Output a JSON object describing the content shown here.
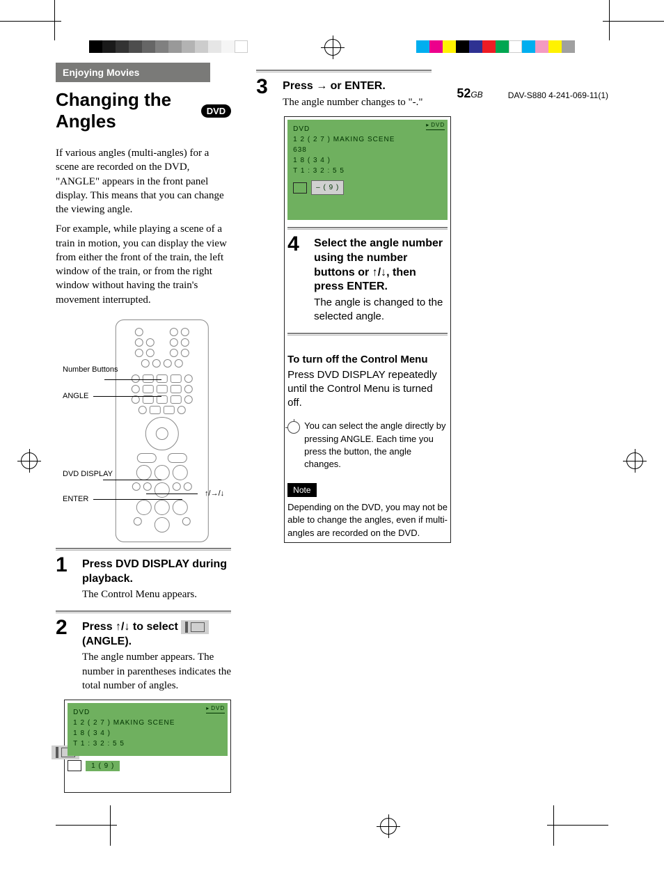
{
  "header": {
    "section_label": "Enjoying Movies",
    "title": "Changing the Angles",
    "title_badge": "DVD"
  },
  "intro": {
    "p1": "If various angles (multi-angles) for a scene are recorded on the DVD, \"ANGLE\" appears in the front panel display. This means that you can change the viewing angle.",
    "p2": "For example, while playing a scene of a train in motion, you can display the view from either the front of the train, the left window of the train, or from the right window without having the train's movement interrupted."
  },
  "remote_labels": {
    "number_buttons": "Number Buttons",
    "angle": "ANGLE",
    "dvd_display": "DVD DISPLAY",
    "enter": "ENTER",
    "arrows": "↑/→/↓"
  },
  "steps": [
    {
      "num": "1",
      "head": "Press DVD DISPLAY during playback.",
      "text": "The Control Menu appears."
    },
    {
      "num": "2",
      "head_pre": "Press ↑/↓ to select",
      "head_post": "(ANGLE).",
      "text": "The angle number appears. The number in parentheses indicates the total number of angles."
    },
    {
      "num": "3",
      "head": "Press → or ENTER.",
      "text": "The angle number changes to \"-.\""
    },
    {
      "num": "4",
      "head": "Select the angle number using the number buttons or ↑/↓, then press ENTER.",
      "text": "The angle is changed to the selected angle."
    }
  ],
  "osd": {
    "line1": "DVD",
    "line2": "1 2 ( 2 7 ) MAKING SCENE",
    "line3": "1 8 ( 3 4 )",
    "line4": "T     1 : 3 2 : 5 5",
    "val_step2": "1 ( 9 )",
    "val_step3": "– ( 9 )",
    "dvd_mini": "DVD"
  },
  "turn_off": {
    "heading": "To turn off the Control Menu",
    "text": "Press DVD DISPLAY repeatedly until the Control Menu is turned off."
  },
  "tip": "You can select the angle directly by pressing ANGLE. Each time you press the button, the angle changes.",
  "note": {
    "label": "Note",
    "text": "Depending on the DVD, you may not be able to change the angles, even if multi-angles are recorded on the DVD."
  },
  "page_number": "52",
  "page_gb": "GB",
  "footer_id": "DAV-S880 4-241-069-11(1)"
}
